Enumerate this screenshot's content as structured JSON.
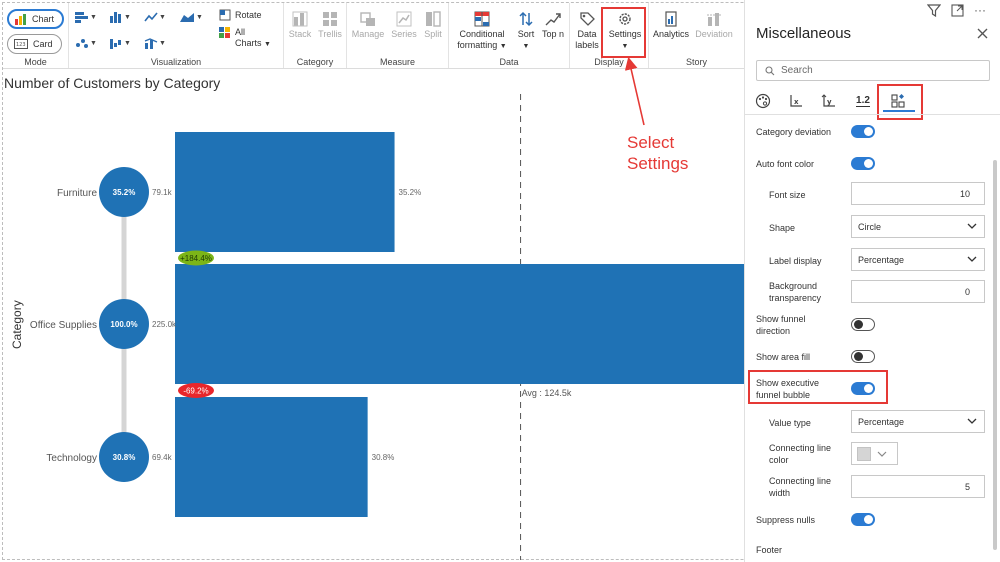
{
  "ribbon": {
    "mode": {
      "label": "Mode",
      "chart": "Chart",
      "card": "Card"
    },
    "visualization": {
      "label": "Visualization",
      "rotate": "Rotate",
      "all_charts_1": "All",
      "all_charts_2": "Charts"
    },
    "category": {
      "label": "Category",
      "stack": "Stack",
      "trellis": "Trellis"
    },
    "measure": {
      "label": "Measure",
      "manage": "Manage",
      "series": "Series",
      "split": "Split"
    },
    "data": {
      "label": "Data",
      "conditional_1": "Conditional",
      "conditional_2": "formatting",
      "sort": "Sort",
      "top_n": "Top n"
    },
    "display": {
      "label": "Display",
      "data_labels_1": "Data",
      "data_labels_2": "labels",
      "settings": "Settings"
    },
    "story": {
      "label": "Story",
      "analytics": "Analytics",
      "deviation": "Deviation"
    }
  },
  "chart": {
    "title": "Number of Customers by Category",
    "axis_title": "Category",
    "avg_label": "Avg : 124.5k"
  },
  "chart_data": {
    "type": "bar",
    "orientation": "horizontal",
    "title": "Number of Customers by Category",
    "ylabel": "Category",
    "categories": [
      "Furniture",
      "Office Supplies",
      "Technology"
    ],
    "values": [
      79.1,
      225.0,
      69.4
    ],
    "value_labels": [
      "79.1k",
      "225.0k",
      "69.4k"
    ],
    "percent_labels": [
      "35.2%",
      "100.0%",
      "30.8%"
    ],
    "bar_percent_labels": [
      "35.2%",
      "",
      "30.8%"
    ],
    "deviations": [
      "+184.4%",
      "-69.2%"
    ],
    "deviation_colors": [
      "#7cb518",
      "#e8262b"
    ],
    "average": 124.5,
    "xlim": [
      0,
      205
    ],
    "bar_color": "#1f72b5",
    "grid": false
  },
  "annotation": {
    "line1": "Select",
    "line2": "Settings"
  },
  "panel": {
    "title": "Miscellaneous",
    "search_placeholder": "Search",
    "tab_number": "1.2",
    "rows": {
      "category_deviation": "Category deviation",
      "auto_font_color": "Auto font color",
      "font_size": "Font size",
      "font_size_value": "10",
      "shape": "Shape",
      "shape_value": "Circle",
      "label_display": "Label display",
      "label_display_value": "Percentage",
      "bg_transparency_1": "Background",
      "bg_transparency_2": "transparency",
      "bg_transparency_value": "0",
      "funnel_direction_1": "Show funnel",
      "funnel_direction_2": "direction",
      "area_fill": "Show area fill",
      "exec_bubble_1": "Show executive",
      "exec_bubble_2": "funnel bubble",
      "value_type": "Value type",
      "value_type_value": "Percentage",
      "line_color_1": "Connecting line",
      "line_color_2": "color",
      "line_width_1": "Connecting line",
      "line_width_2": "width",
      "line_width_value": "5",
      "suppress_nulls": "Suppress nulls",
      "footer": "Footer"
    }
  }
}
